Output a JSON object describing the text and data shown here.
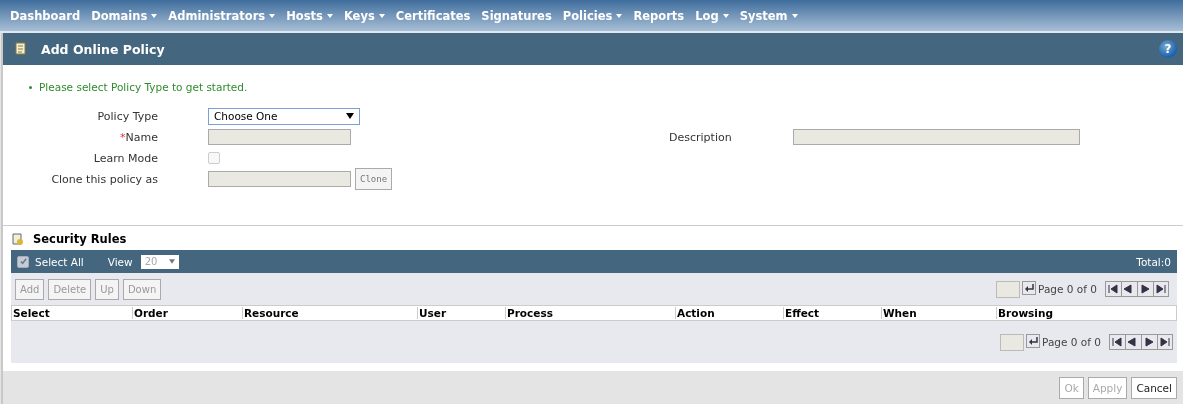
{
  "nav": [
    {
      "label": "Dashboard",
      "has_menu": false
    },
    {
      "label": "Domains",
      "has_menu": true
    },
    {
      "label": "Administrators",
      "has_menu": true
    },
    {
      "label": "Hosts",
      "has_menu": true
    },
    {
      "label": "Keys",
      "has_menu": true
    },
    {
      "label": "Certificates",
      "has_menu": false
    },
    {
      "label": "Signatures",
      "has_menu": false
    },
    {
      "label": "Policies",
      "has_menu": true
    },
    {
      "label": "Reports",
      "has_menu": false
    },
    {
      "label": "Log",
      "has_menu": true
    },
    {
      "label": "System",
      "has_menu": true
    }
  ],
  "panel": {
    "title": "Add Online Policy",
    "help": "?"
  },
  "message": "Please select Policy Type to get started.",
  "form": {
    "policy_type": {
      "label": "Policy Type",
      "value": "Choose One"
    },
    "name": {
      "label": "Name",
      "required_mark": "*"
    },
    "description": {
      "label": "Description"
    },
    "learn_mode": {
      "label": "Learn Mode",
      "checked": false,
      "disabled": true
    },
    "clone": {
      "label": "Clone this policy as",
      "button": "Clone"
    }
  },
  "rules": {
    "title": "Security Rules",
    "select_all": {
      "label": "Select All",
      "checked": true
    },
    "view": {
      "label": "View",
      "value": "20"
    },
    "total": "Total:0",
    "buttons": [
      "Add",
      "Delete",
      "Up",
      "Down"
    ],
    "page_text_top": "Page 0 of 0",
    "columns": [
      "Select",
      "Order",
      "Resource",
      "User",
      "Process",
      "Action",
      "Effect",
      "When",
      "Browsing"
    ],
    "page_text_bottom": "Page 0 of 0"
  },
  "footer_buttons": [
    {
      "label": "Ok",
      "disabled": true
    },
    {
      "label": "Apply",
      "disabled": true
    },
    {
      "label": "Cancel",
      "disabled": false
    }
  ]
}
